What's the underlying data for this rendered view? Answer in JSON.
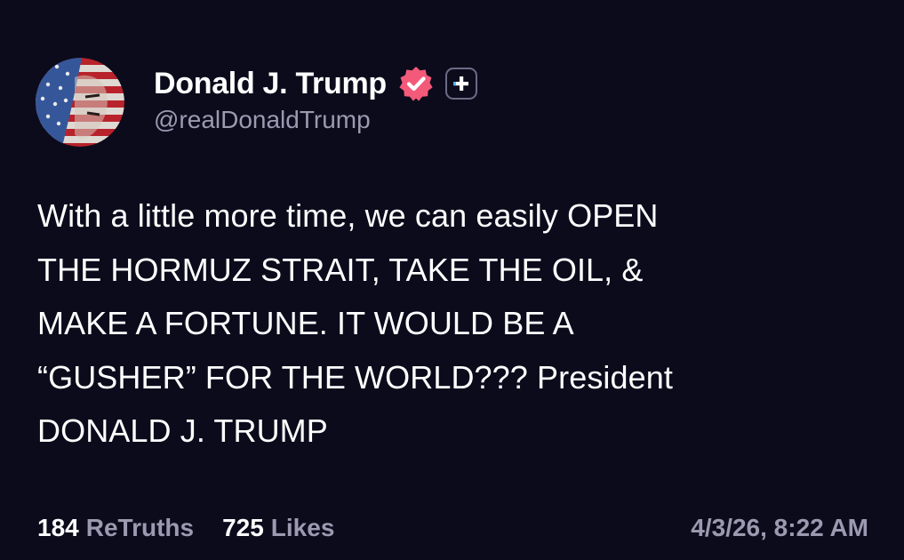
{
  "author": {
    "display_name": "Donald J. Trump",
    "handle": "@realDonaldTrump",
    "avatar_icon": "american-flag-portrait-avatar",
    "verified_icon": "verified-badge-icon",
    "verified_color": "#f35a7a",
    "follow_icon": "plus-icon"
  },
  "post": {
    "lines": [
      "With a little more time, we can easily OPEN",
      "THE HORMUZ STRAIT, TAKE THE OIL, &",
      "MAKE A FORTUNE. IT WOULD BE A",
      "“GUSHER” FOR THE WORLD??? President",
      "DONALD J. TRUMP"
    ]
  },
  "stats": {
    "retruths_count": "184",
    "retruths_label": "ReTruths",
    "likes_count": "725",
    "likes_label": "Likes"
  },
  "timestamp": "4/3/26, 8:22 AM",
  "colors": {
    "background": "#0c0b1c",
    "text": "#ffffff",
    "muted": "#9a9ab0"
  }
}
